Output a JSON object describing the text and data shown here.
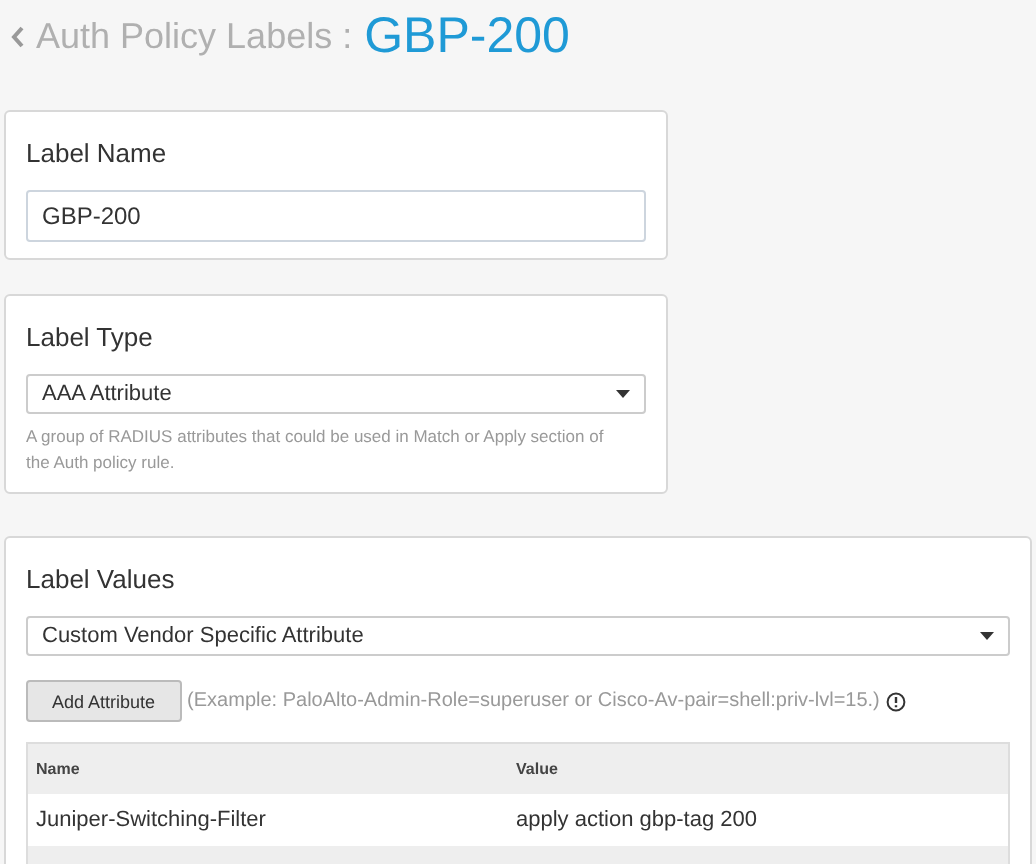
{
  "header": {
    "back": "Auth Policy Labels :",
    "title": "GBP-200"
  },
  "label_name": {
    "title": "Label Name",
    "value": "GBP-200"
  },
  "label_type": {
    "title": "Label Type",
    "value": "AAA Attribute",
    "help": "A group of RADIUS attributes that could be used in Match or Apply section of the Auth policy rule."
  },
  "label_values": {
    "title": "Label Values",
    "select": "Custom Vendor Specific Attribute",
    "add_button": "Add Attribute",
    "example": "(Example: PaloAlto-Admin-Role=superuser or Cisco-Av-pair=shell:priv-lvl=15.)",
    "table": {
      "columns": [
        "Name",
        "Value"
      ],
      "rows": [
        {
          "name": "Juniper-Switching-Filter",
          "value": "apply action gbp-tag 200"
        }
      ]
    }
  }
}
